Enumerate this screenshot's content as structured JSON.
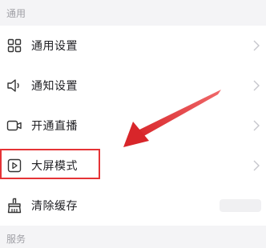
{
  "sections": {
    "general_header": "通用",
    "service_header": "服务"
  },
  "items": [
    {
      "label": "通用设置",
      "icon": "grid-icon"
    },
    {
      "label": "通知设置",
      "icon": "speaker-icon"
    },
    {
      "label": "开通直播",
      "icon": "video-camera-icon"
    },
    {
      "label": "大屏模式",
      "icon": "play-screen-icon"
    },
    {
      "label": "清除缓存",
      "icon": "broom-icon"
    }
  ],
  "colors": {
    "highlight": "#e53336",
    "text": "#1f1f23",
    "muted": "#a0a0a6",
    "chevron": "#c6c6cc"
  }
}
